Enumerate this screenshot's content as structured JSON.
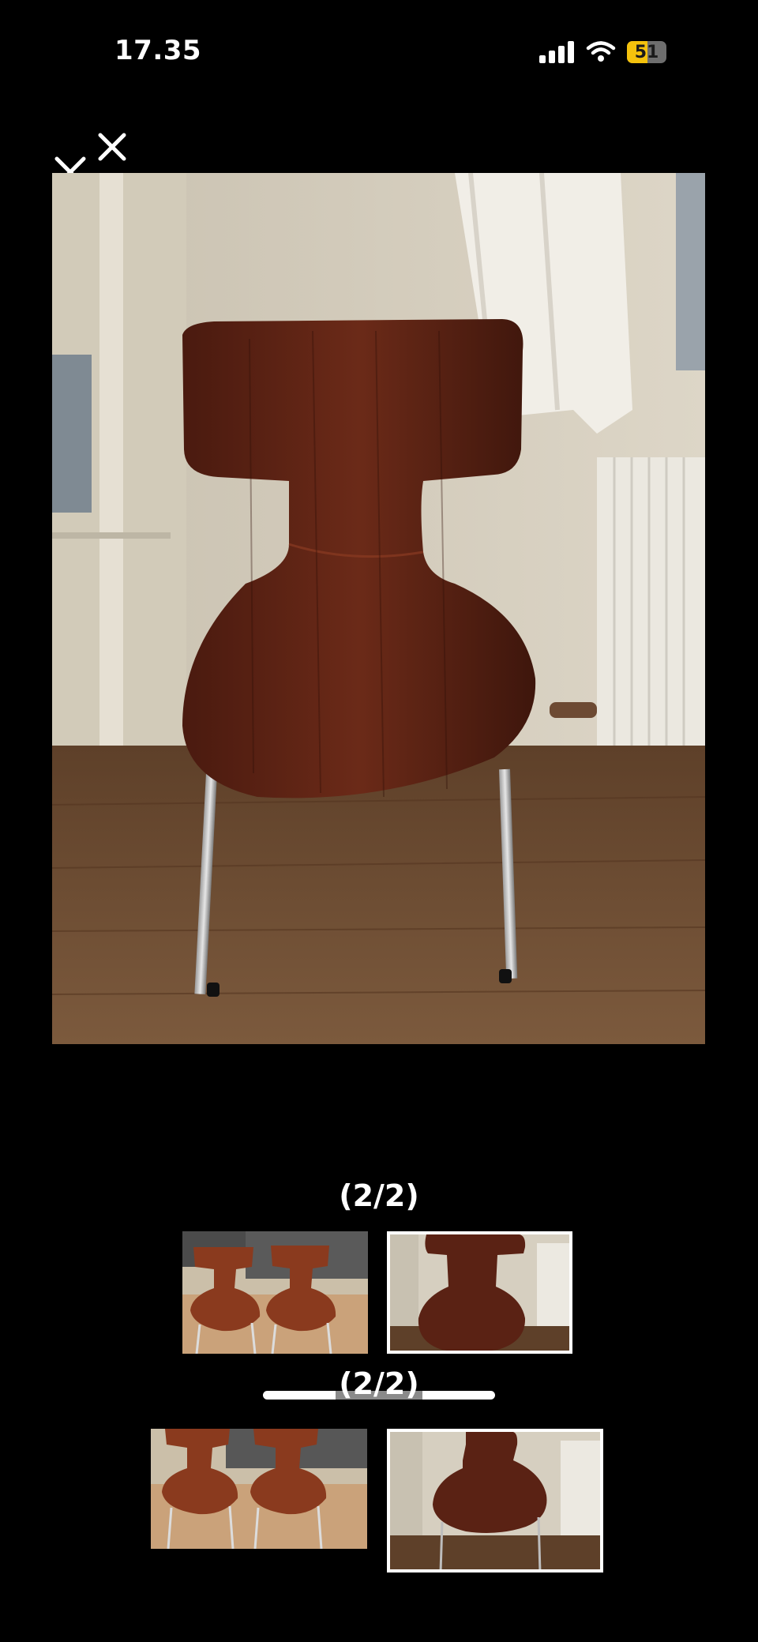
{
  "status_bar": {
    "time": "17.35",
    "battery_level": 51,
    "battery_color": "#f4c20d"
  },
  "viewer": {
    "close_icon": "close-icon",
    "counter": "(2/2)",
    "current_index": 2,
    "total": 2
  },
  "colors": {
    "background": "#000000",
    "chair_wood": "#5a2214",
    "wall": "#d9d2c4",
    "floor": "#6b4b31"
  }
}
